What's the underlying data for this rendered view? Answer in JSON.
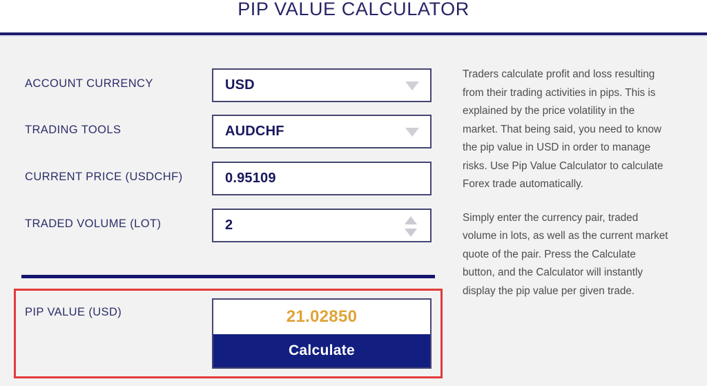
{
  "header": {
    "title": "PIP VALUE CALCULATOR"
  },
  "form": {
    "rows": [
      {
        "label": "ACCOUNT CURRENCY",
        "value": "USD",
        "control": "dropdown",
        "icon": "chevron-down-icon"
      },
      {
        "label": "TRADING TOOLS",
        "value": "AUDCHF",
        "control": "dropdown",
        "icon": "chevron-down-icon"
      },
      {
        "label": "CURRENT PRICE (USDCHF)",
        "value": "0.95109",
        "control": "text",
        "icon": ""
      },
      {
        "label": "TRADED VOLUME (LOT)",
        "value": "2",
        "control": "number",
        "icon": "spinner-icon"
      }
    ]
  },
  "result": {
    "label": "PIP VALUE (USD)",
    "value": "21.02850",
    "button_label": "Calculate"
  },
  "description": {
    "paragraphs": [
      "Traders calculate profit and loss resulting from their trading activities in pips. This is explained by the price volatility in the market. That being said, you need to know the pip value in USD in order to manage risks. Use Pip Value Calculator to calculate Forex trade automatically.",
      "Simply enter the currency pair, traded volume in lots, as well as the current market quote of the pair. Press the Calculate button, and the Calculator will instantly display the pip value per given trade."
    ]
  },
  "colors": {
    "navy": "#151570",
    "title_navy": "#252466",
    "label_navy": "#2d2d6b",
    "value_navy": "#17175e",
    "gold": "#e0a337",
    "button_navy": "#121f80",
    "highlight_red": "#e23a3a",
    "panel_bg": "#f2f2f2",
    "body_text": "#4d4d4d"
  }
}
